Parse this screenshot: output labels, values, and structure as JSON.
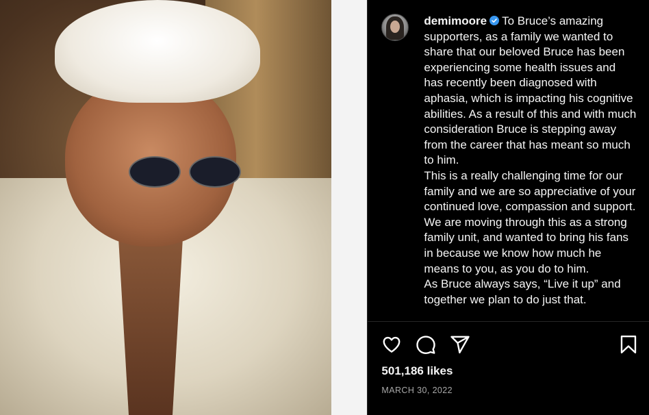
{
  "post": {
    "username": "demimoore",
    "caption_lines": [
      "To Bruce’s amazing supporters, as a family we wanted to share that our beloved Bruce has been experiencing some health issues and has recently been diagnosed with aphasia, which is impacting his cognitive abilities. As a result of this and with much consideration Bruce is stepping away from the career that has meant so much to him.",
      "This is a really challenging time for our family and we are so appreciative of your continued love, compassion and support. We are moving through this as a strong family unit, and wanted to bring his fans in because we know how much he means to you, as you do to him.",
      "As Bruce always says, “Live it up” and together we plan to do just that."
    ],
    "likes": "501,186 likes",
    "date": "MARCH 30, 2022"
  },
  "icons": {
    "like": "heart-icon",
    "comment": "comment-icon",
    "share": "send-icon",
    "save": "bookmark-icon",
    "verified": "verified-badge-icon"
  },
  "colors": {
    "background": "#000000",
    "text": "#f5f5f5",
    "secondary_text": "#a8a8a8",
    "verified": "#3897f0"
  }
}
